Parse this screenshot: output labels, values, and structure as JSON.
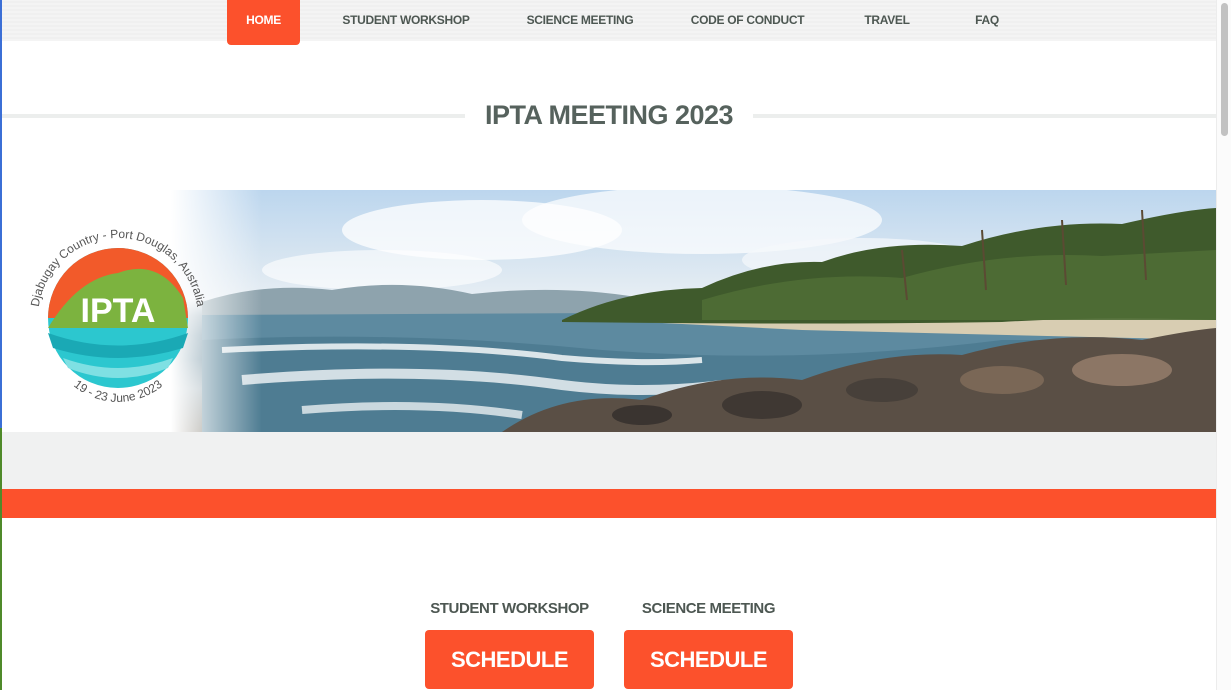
{
  "nav": {
    "items": [
      {
        "label": "HOME",
        "active": true
      },
      {
        "label": "STUDENT WORKSHOP",
        "active": false
      },
      {
        "label": "SCIENCE MEETING",
        "active": false
      },
      {
        "label": "CODE OF CONDUCT",
        "active": false
      },
      {
        "label": "TRAVEL",
        "active": false
      },
      {
        "label": "FAQ",
        "active": false
      }
    ]
  },
  "page_title": "IPTA MEETING 2023",
  "banner": {
    "logo": {
      "arc_text_top": "Djabugay Country - Port Douglas, Australia",
      "center_text": "IPTA",
      "arc_text_bottom": "19 - 23 June 2023"
    }
  },
  "schedules": [
    {
      "heading": "STUDENT WORKSHOP",
      "button_label": "SCHEDULE"
    },
    {
      "heading": "SCIENCE MEETING",
      "button_label": "SCHEDULE"
    }
  ],
  "colors": {
    "accent": "#fc512c",
    "heading_text": "#56625d",
    "nav_text": "#4d5752"
  }
}
